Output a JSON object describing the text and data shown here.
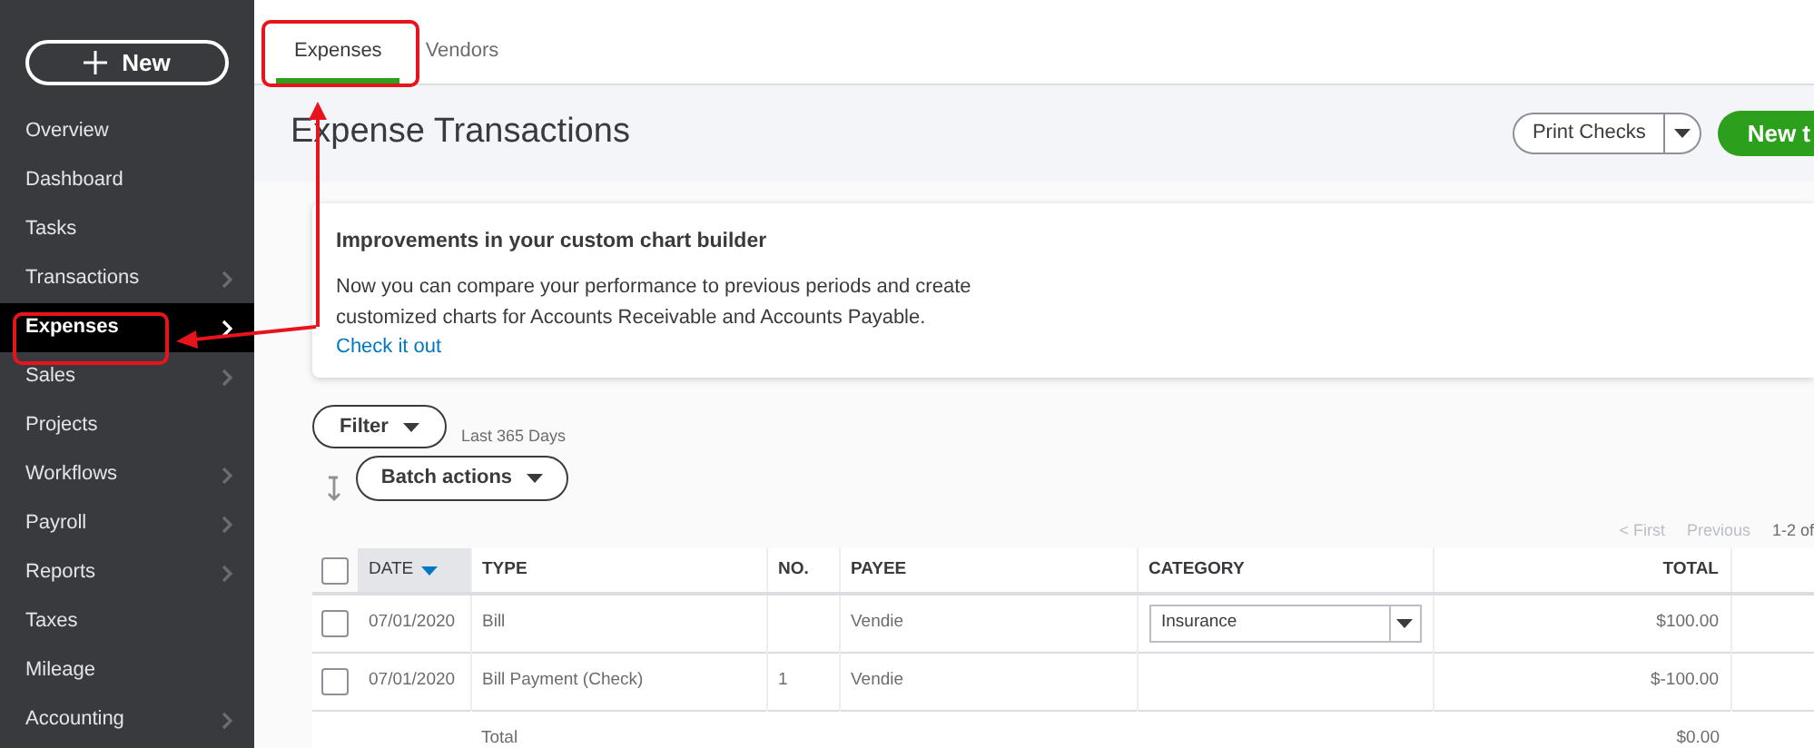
{
  "sidebar": {
    "new_button": "New",
    "items": [
      {
        "label": "Overview",
        "expandable": false,
        "selected": false
      },
      {
        "label": "Dashboard",
        "expandable": false,
        "selected": false
      },
      {
        "label": "Tasks",
        "expandable": false,
        "selected": false
      },
      {
        "label": "Transactions",
        "expandable": true,
        "selected": false
      },
      {
        "label": "Expenses",
        "expandable": true,
        "selected": true
      },
      {
        "label": "Sales",
        "expandable": true,
        "selected": false
      },
      {
        "label": "Projects",
        "expandable": false,
        "selected": false
      },
      {
        "label": "Workflows",
        "expandable": true,
        "selected": false
      },
      {
        "label": "Payroll",
        "expandable": true,
        "selected": false
      },
      {
        "label": "Reports",
        "expandable": true,
        "selected": false
      },
      {
        "label": "Taxes",
        "expandable": false,
        "selected": false
      },
      {
        "label": "Mileage",
        "expandable": false,
        "selected": false
      },
      {
        "label": "Accounting",
        "expandable": true,
        "selected": false
      }
    ]
  },
  "tabs": [
    {
      "label": "Expenses",
      "selected": true
    },
    {
      "label": "Vendors",
      "selected": false
    }
  ],
  "page_title": "Expense Transactions",
  "header_buttons": {
    "print_checks": "Print Checks",
    "new_transaction": "New t"
  },
  "card": {
    "title": "Improvements in your custom chart builder",
    "body": "Now you can compare your performance to previous periods and create customized charts for Accounts Receivable and Accounts Payable.",
    "link": "Check it out"
  },
  "filter": {
    "label": "Filter",
    "range": "Last 365 Days"
  },
  "batch_actions": "Batch actions",
  "pagination": {
    "first": "< First",
    "previous": "Previous",
    "range": "1-2 of"
  },
  "table": {
    "select_all_checked": false,
    "columns": [
      {
        "label": "DATE",
        "sorted": true
      },
      {
        "label": "TYPE",
        "sorted": false
      },
      {
        "label": "NO.",
        "sorted": false
      },
      {
        "label": "PAYEE",
        "sorted": false
      },
      {
        "label": "CATEGORY",
        "sorted": false
      },
      {
        "label": "TOTAL",
        "sorted": false
      }
    ],
    "rows": [
      {
        "checked": false,
        "date": "07/01/2020",
        "type": "Bill",
        "no": "",
        "payee": "Vendie",
        "category": {
          "kind": "select",
          "value": "Insurance"
        },
        "total": "$100.00"
      },
      {
        "checked": false,
        "date": "07/01/2020",
        "type": "Bill Payment (Check)",
        "no": "1",
        "payee": "Vendie",
        "category": {
          "kind": "empty"
        },
        "total": "$-100.00"
      }
    ],
    "total_row": {
      "label": "Total",
      "total": "$0.00"
    }
  }
}
